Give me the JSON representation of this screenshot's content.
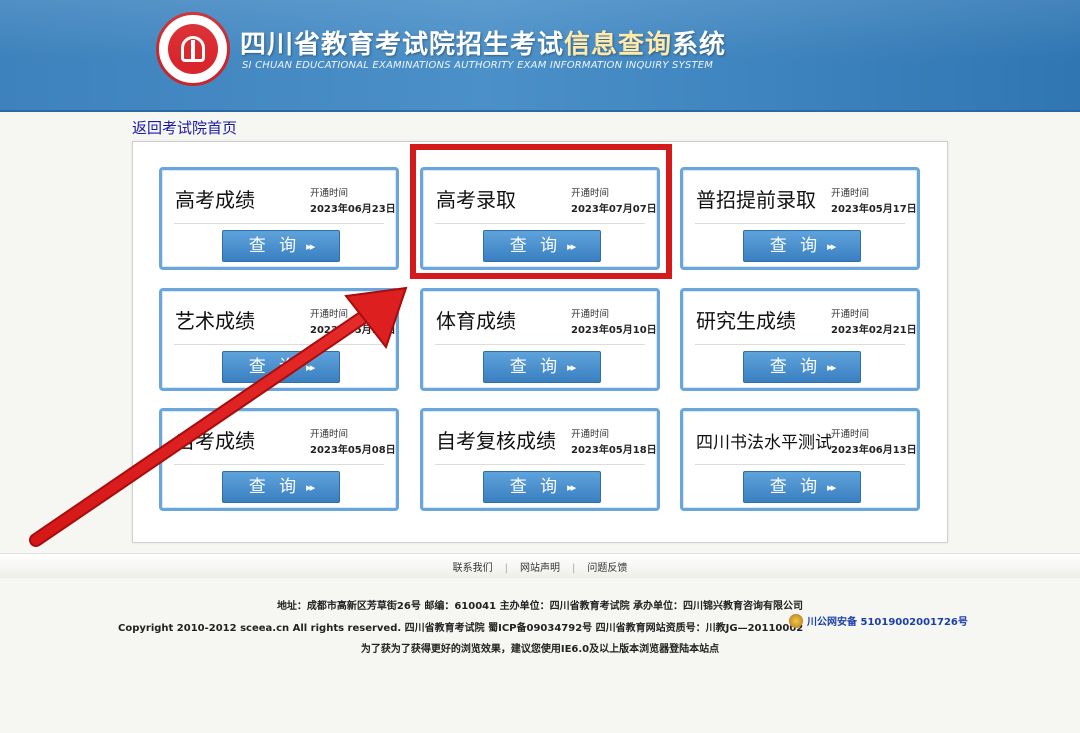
{
  "header": {
    "title_main": "四川省教育考试院招生考试",
    "title_highlight": "信息查询",
    "title_end": "系统",
    "subtitle": "SI CHUAN EDUCATIONAL EXAMINATIONS AUTHORITY EXAM INFORMATION INQUIRY SYSTEM"
  },
  "nav": {
    "back_link": "返回考试院首页"
  },
  "cards": [
    {
      "name": "高考成绩",
      "open_label": "开通时间",
      "date": "2023年06月23日",
      "button": "查 询"
    },
    {
      "name": "高考录取",
      "open_label": "开通时间",
      "date": "2023年07月07日",
      "button": "查 询"
    },
    {
      "name": "普招提前录取",
      "open_label": "开通时间",
      "date": "2023年05月17日",
      "button": "查 询"
    },
    {
      "name": "艺术成绩",
      "open_label": "开通时间",
      "date": "2023年05月15日",
      "button": "查 询"
    },
    {
      "name": "体育成绩",
      "open_label": "开通时间",
      "date": "2023年05月10日",
      "button": "查 询"
    },
    {
      "name": "研究生成绩",
      "open_label": "开通时间",
      "date": "2023年02月21日",
      "button": "查 询"
    },
    {
      "name": "自考成绩",
      "open_label": "开通时间",
      "date": "2023年05月08日",
      "button": "查 询"
    },
    {
      "name": "自考复核成绩",
      "open_label": "开通时间",
      "date": "2023年05月18日",
      "button": "查 询"
    },
    {
      "name": "四川书法水平测试",
      "open_label": "开通时间",
      "date": "2023年06月13日",
      "button": "查 询"
    }
  ],
  "footer": {
    "links": [
      "联系我们",
      "网站声明",
      "问题反馈"
    ],
    "address_line": "地址：成都市高新区芳草街26号  邮编：610041      主办单位：四川省教育考试院  承办单位：四川锦兴教育咨询有限公司",
    "copyright_line": "Copyright 2010-2012 sceea.cn All rights reserved. 四川省教育考试院      蜀ICP备09034792号 四川省教育网站资质号：川教JG—20110002",
    "police_record": "川公网安备 51019002001726号",
    "browser_tip": "为了获为了获得更好的浏览效果，建议您使用IE6.0及以上版本浏览器登陆本站点"
  },
  "colors": {
    "header_blue": "#3d82bd",
    "button_blue": "#3a7fc0",
    "card_border": "#6aa6dc",
    "highlight_red": "#d41a1a",
    "link_blue": "#1a1aa8"
  }
}
